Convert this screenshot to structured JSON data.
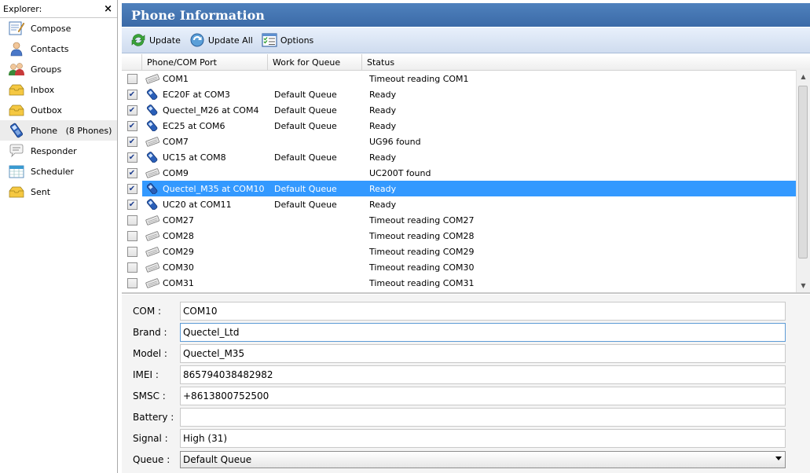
{
  "explorer": {
    "title": "Explorer:",
    "close": "×",
    "items": [
      {
        "label": "Compose",
        "icon": "compose-icon"
      },
      {
        "label": "Contacts",
        "icon": "contacts-icon"
      },
      {
        "label": "Groups",
        "icon": "groups-icon"
      },
      {
        "label": "Inbox",
        "icon": "inbox-icon"
      },
      {
        "label": "Outbox",
        "icon": "outbox-icon"
      },
      {
        "label": "Phone   (8 Phones)",
        "icon": "phone-icon"
      },
      {
        "label": "Responder",
        "icon": "responder-icon"
      },
      {
        "label": "Scheduler",
        "icon": "scheduler-icon"
      },
      {
        "label": "Sent",
        "icon": "sent-icon"
      }
    ]
  },
  "header": {
    "title": "Phone Information"
  },
  "toolbar": {
    "update_label": "Update",
    "update_all_label": "Update All",
    "options_label": "Options"
  },
  "grid": {
    "columns": [
      "Phone/COM Port",
      "Work for Queue",
      "Status"
    ],
    "rows": [
      {
        "checked": false,
        "port": "COM1",
        "queue": "",
        "status": "Timeout reading COM1"
      },
      {
        "checked": true,
        "port": "EC20F at COM3",
        "queue": "Default Queue",
        "status": "Ready"
      },
      {
        "checked": true,
        "port": "Quectel_M26 at COM4",
        "queue": "Default Queue",
        "status": "Ready"
      },
      {
        "checked": true,
        "port": "EC25 at COM6",
        "queue": "Default Queue",
        "status": "Ready"
      },
      {
        "checked": true,
        "port": "COM7",
        "queue": "",
        "status": "UG96 found"
      },
      {
        "checked": true,
        "port": "UC15 at COM8",
        "queue": "Default Queue",
        "status": "Ready"
      },
      {
        "checked": true,
        "port": "COM9",
        "queue": "",
        "status": "UC200T found"
      },
      {
        "checked": true,
        "port": "Quectel_M35 at COM10",
        "queue": "Default Queue",
        "status": "Ready",
        "selected": true
      },
      {
        "checked": true,
        "port": "UC20 at COM11",
        "queue": "Default Queue",
        "status": "Ready"
      },
      {
        "checked": false,
        "port": "COM27",
        "queue": "",
        "status": "Timeout reading COM27"
      },
      {
        "checked": false,
        "port": "COM28",
        "queue": "",
        "status": "Timeout reading COM28"
      },
      {
        "checked": false,
        "port": "COM29",
        "queue": "",
        "status": "Timeout reading COM29"
      },
      {
        "checked": false,
        "port": "COM30",
        "queue": "",
        "status": "Timeout reading COM30"
      },
      {
        "checked": false,
        "port": "COM31",
        "queue": "",
        "status": "Timeout reading COM31"
      }
    ]
  },
  "details": {
    "com": {
      "label": "COM :",
      "value": "COM10"
    },
    "brand": {
      "label": "Brand :",
      "value": "Quectel_Ltd"
    },
    "model": {
      "label": "Model :",
      "value": "Quectel_M35"
    },
    "imei": {
      "label": "IMEI :",
      "value": "865794038482982"
    },
    "smsc": {
      "label": "SMSC :",
      "value": "+8613800752500"
    },
    "battery": {
      "label": "Battery :",
      "value": ""
    },
    "signal": {
      "label": "Signal :",
      "value": "High (31)"
    },
    "queue": {
      "label": "Queue :",
      "value": "Default Queue"
    }
  }
}
